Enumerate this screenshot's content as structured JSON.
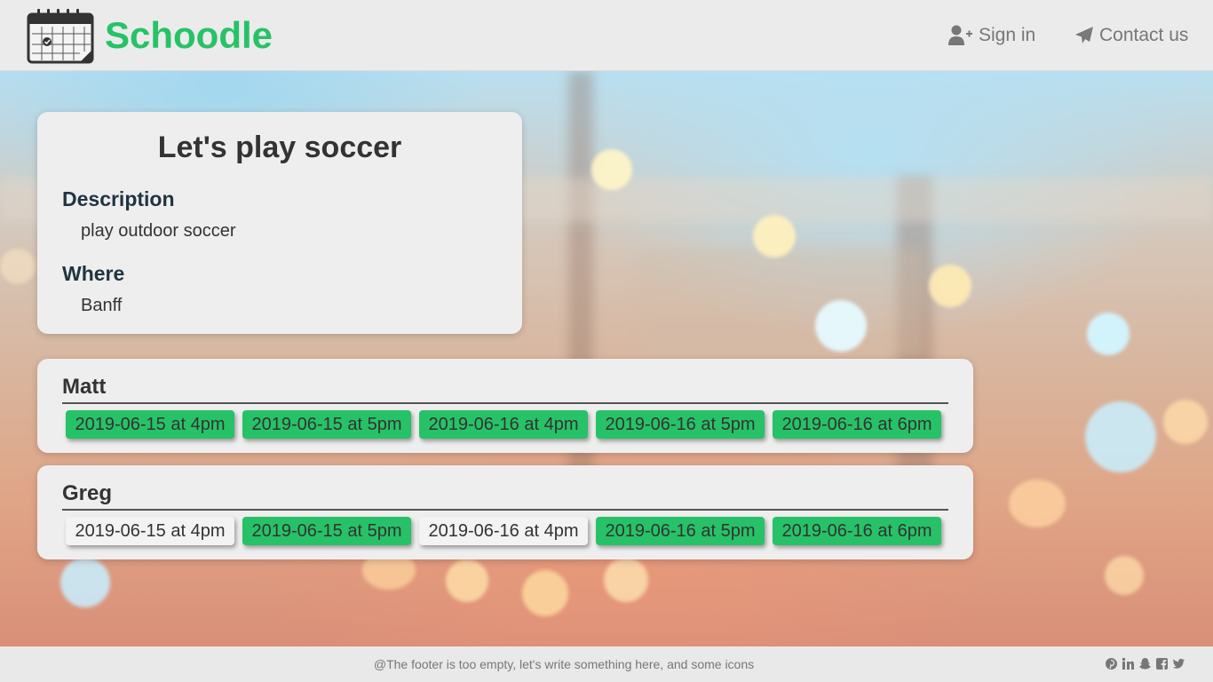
{
  "header": {
    "brand": "Schoodle",
    "nav": {
      "sign_in": "Sign in",
      "contact": "Contact us"
    }
  },
  "event": {
    "title": "Let's play soccer",
    "description_label": "Description",
    "description": "play outdoor soccer",
    "where_label": "Where",
    "where": "Banff"
  },
  "participants": [
    {
      "name": "Matt",
      "slots": [
        {
          "label": "2019-06-15 at 4pm",
          "selected": true
        },
        {
          "label": "2019-06-15 at 5pm",
          "selected": true
        },
        {
          "label": "2019-06-16 at 4pm",
          "selected": true
        },
        {
          "label": "2019-06-16 at 5pm",
          "selected": true
        },
        {
          "label": "2019-06-16 at 6pm",
          "selected": true
        }
      ]
    },
    {
      "name": "Greg",
      "slots": [
        {
          "label": "2019-06-15 at 4pm",
          "selected": false
        },
        {
          "label": "2019-06-15 at 5pm",
          "selected": true
        },
        {
          "label": "2019-06-16 at 4pm",
          "selected": false
        },
        {
          "label": "2019-06-16 at 5pm",
          "selected": true
        },
        {
          "label": "2019-06-16 at 6pm",
          "selected": true
        }
      ]
    }
  ],
  "footer": {
    "text": "@The footer is too empty, let's write something here, and some icons",
    "icons": [
      "pinterest-icon",
      "linkedin-icon",
      "snapchat-icon",
      "facebook-icon",
      "twitter-icon"
    ]
  },
  "colors": {
    "brand": "#27c267",
    "slot_selected": "#27c267",
    "slot_unselected": "#f3f3f3",
    "card": "#eeeeee",
    "nav_text": "#777777"
  }
}
